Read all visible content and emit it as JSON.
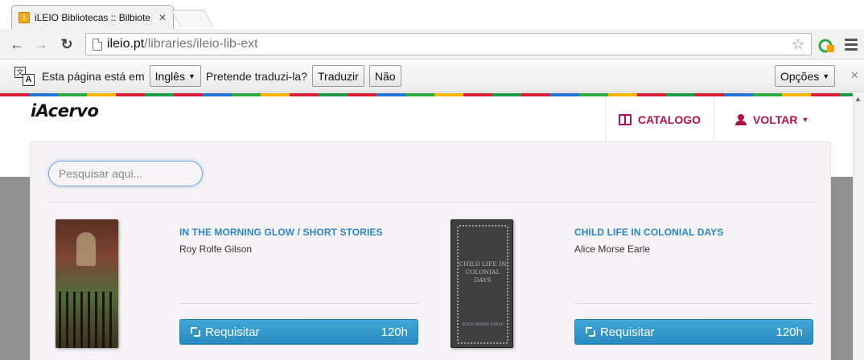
{
  "browser": {
    "tab_title": "iLEIO Bibliotecas :: Bilbiote",
    "tab_favicon": "iLEIO-favicon",
    "url_host": "ileio.pt",
    "url_path": "/libraries/ileio-lib-ext"
  },
  "translate_bar": {
    "text_prefix": "Esta página está em",
    "language": "Inglês",
    "question": "Pretende traduzi-la?",
    "translate_label": "Traduzir",
    "no_label": "Não",
    "options_label": "Opções"
  },
  "site": {
    "brand": "iAcervo",
    "nav": {
      "catalogo": "CATALOGO",
      "voltar": "VOLTAR"
    },
    "accent_color": "#b01343",
    "link_color": "#2b86c8"
  },
  "search": {
    "placeholder": "Pesquisar aqui..."
  },
  "books": [
    {
      "title": "IN THE MORNING GLOW / SHORT STORIES",
      "author": "Roy Rolfe Gilson",
      "button_label": "Requisitar",
      "hours": "120h"
    },
    {
      "title": "CHILD LIFE IN COLONIAL DAYS",
      "author": "Alice Morse Earle",
      "button_label": "Requisitar",
      "hours": "120h",
      "cover_title": "CHILD LIFE IN COLONIAL DAYS",
      "cover_author": "ALICE MORSE EARLE"
    }
  ]
}
